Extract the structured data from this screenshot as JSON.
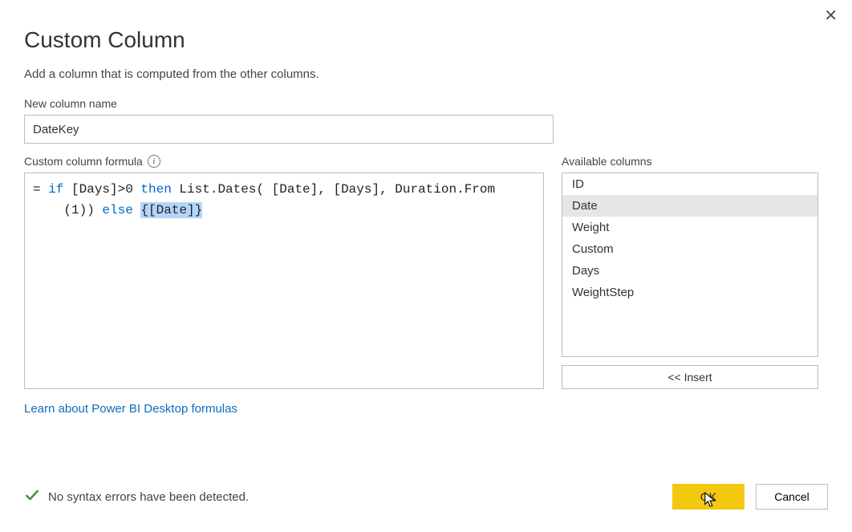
{
  "dialog": {
    "title": "Custom Column",
    "subtitle": "Add a column that is computed from the other columns.",
    "new_column_label": "New column name",
    "new_column_value": "DateKey",
    "formula_label": "Custom column formula",
    "formula": {
      "line1_prefix": "= ",
      "kw_if": "if",
      "cond": " [Days]>0 ",
      "kw_then": "then",
      "fn_call": " List.Dates( [Date], [Days], Duration.From",
      "line2_indent": "    ",
      "fn_tail": "(1)) ",
      "kw_else": "else",
      "space": " ",
      "selected": "{[Date]}"
    },
    "available_label": "Available columns",
    "available_columns": [
      "ID",
      "Date",
      "Weight",
      "Custom",
      "Days",
      "WeightStep"
    ],
    "selected_column": "Date",
    "insert_label": "<< Insert",
    "learn_link": "Learn about Power BI Desktop formulas",
    "status_text": "No syntax errors have been detected.",
    "ok_label": "OK",
    "cancel_label": "Cancel"
  }
}
